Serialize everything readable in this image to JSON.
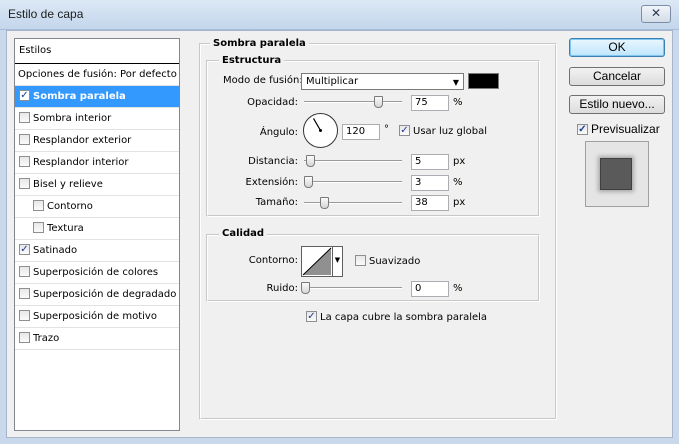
{
  "window": {
    "title": "Estilo de capa",
    "close_label": "✕"
  },
  "stylelist": {
    "header": "Estilos",
    "items": [
      {
        "label": "Opciones de fusión: Por defecto",
        "checkbox": false,
        "checked": false,
        "selected": false,
        "sub": false
      },
      {
        "label": "Sombra paralela",
        "checkbox": true,
        "checked": true,
        "selected": true,
        "sub": false
      },
      {
        "label": "Sombra interior",
        "checkbox": true,
        "checked": false,
        "selected": false,
        "sub": false
      },
      {
        "label": "Resplandor exterior",
        "checkbox": true,
        "checked": false,
        "selected": false,
        "sub": false
      },
      {
        "label": "Resplandor interior",
        "checkbox": true,
        "checked": false,
        "selected": false,
        "sub": false
      },
      {
        "label": "Bisel y relieve",
        "checkbox": true,
        "checked": false,
        "selected": false,
        "sub": false
      },
      {
        "label": "Contorno",
        "checkbox": true,
        "checked": false,
        "selected": false,
        "sub": true
      },
      {
        "label": "Textura",
        "checkbox": true,
        "checked": false,
        "selected": false,
        "sub": true
      },
      {
        "label": "Satinado",
        "checkbox": true,
        "checked": true,
        "selected": false,
        "sub": false
      },
      {
        "label": "Superposición de colores",
        "checkbox": true,
        "checked": false,
        "selected": false,
        "sub": false
      },
      {
        "label": "Superposición de degradado",
        "checkbox": true,
        "checked": false,
        "selected": false,
        "sub": false
      },
      {
        "label": "Superposición de motivo",
        "checkbox": true,
        "checked": false,
        "selected": false,
        "sub": false
      },
      {
        "label": "Trazo",
        "checkbox": true,
        "checked": false,
        "selected": false,
        "sub": false
      }
    ]
  },
  "panel": {
    "title": "Sombra paralela",
    "estructura": {
      "legend": "Estructura",
      "blend_label": "Modo de fusión:",
      "blend_value": "Multiplicar",
      "blend_color": "#000000",
      "opacity_label": "Opacidad:",
      "opacity_value": "75",
      "opacity_unit": "%",
      "opacity_level": 0.75,
      "angle_label": "Ángulo:",
      "angle_value": "120",
      "angle_unit": "°",
      "global_light_label": "Usar luz global",
      "global_light_checked": true,
      "distance_label": "Distancia:",
      "distance_value": "5",
      "distance_unit": "px",
      "spread_label": "Extensión:",
      "spread_value": "3",
      "spread_unit": "%",
      "size_label": "Tamaño:",
      "size_value": "38",
      "size_unit": "px"
    },
    "calidad": {
      "legend": "Calidad",
      "contour_label": "Contorno:",
      "antialias_label": "Suavizado",
      "antialias_checked": false,
      "noise_label": "Ruido:",
      "noise_value": "0",
      "noise_unit": "%"
    },
    "knockout_label": "La capa cubre la sombra paralela",
    "knockout_checked": true
  },
  "buttons": {
    "ok": "OK",
    "cancel": "Cancelar",
    "new_style": "Estilo nuevo...",
    "preview_label": "Previsualizar",
    "preview_checked": true
  }
}
